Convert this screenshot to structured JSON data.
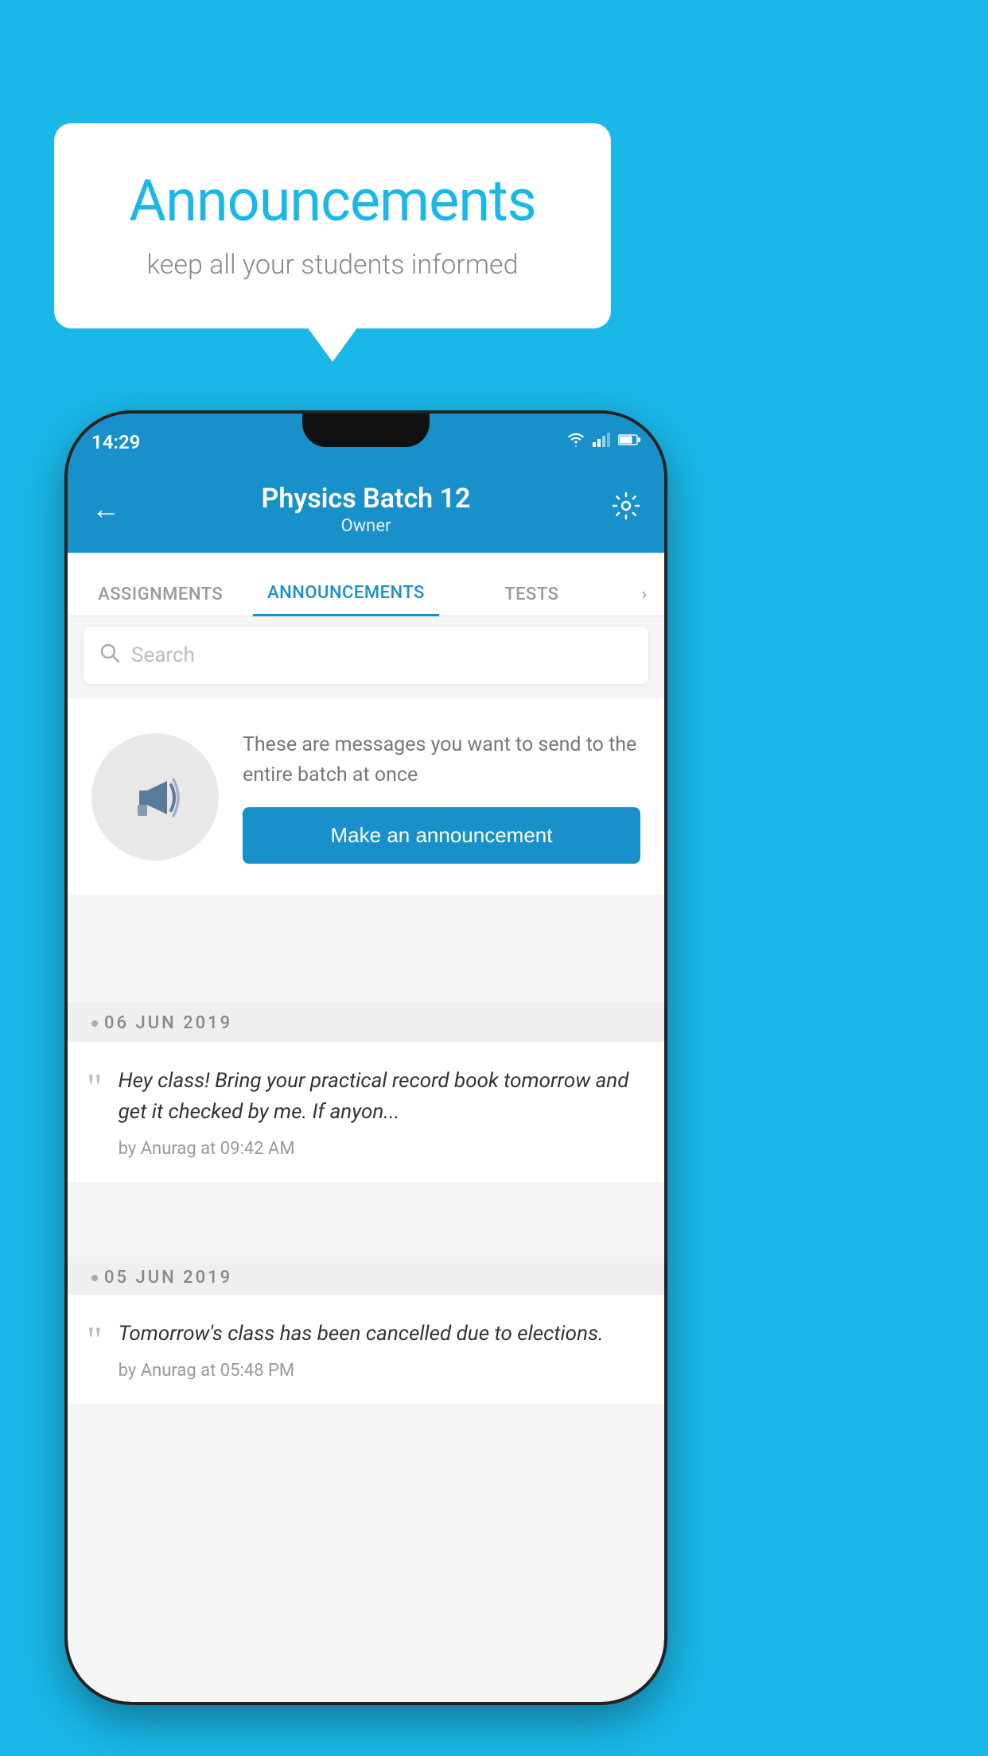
{
  "background_color": "#1ab8e8",
  "speech_bubble": {
    "title": "Announcements",
    "subtitle": "keep all your students informed"
  },
  "phone": {
    "status_bar": {
      "time": "14:29",
      "icons": [
        "wifi",
        "signal",
        "battery"
      ]
    },
    "header": {
      "title": "Physics Batch 12",
      "subtitle": "Owner",
      "back_label": "←",
      "settings_label": "⚙"
    },
    "tabs": [
      {
        "label": "ASSIGNMENTS",
        "active": false
      },
      {
        "label": "ANNOUNCEMENTS",
        "active": true
      },
      {
        "label": "TESTS",
        "active": false
      }
    ],
    "search": {
      "placeholder": "Search"
    },
    "announcement_prompt": {
      "description": "These are messages you want to send to the entire batch at once",
      "button_label": "Make an announcement"
    },
    "dates": [
      {
        "text": "06  JUN  2019"
      },
      {
        "text": "05  JUN  2019"
      }
    ],
    "announcements": [
      {
        "message": "Hey class! Bring your practical record book tomorrow and get it checked by me. If anyon...",
        "meta": "by Anurag at 09:42 AM"
      },
      {
        "message": "Tomorrow's class has been cancelled due to elections.",
        "meta": "by Anurag at 05:48 PM"
      }
    ]
  }
}
